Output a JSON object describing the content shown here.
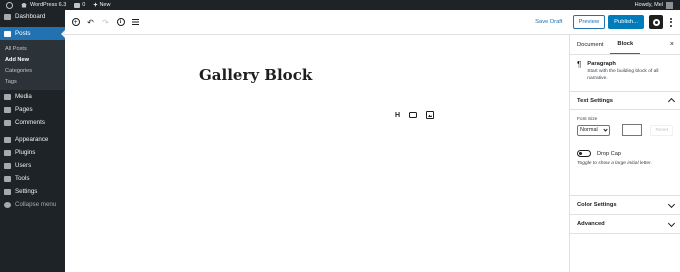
{
  "admin_bar": {
    "site_name": "WordPress 6.3",
    "comments_count": "0",
    "new_label": "New",
    "greeting": "Howdy, Mel"
  },
  "admin_menu": {
    "dashboard": "Dashboard",
    "posts": "Posts",
    "posts_submenu": [
      "All Posts",
      "Add New",
      "Categories",
      "Tags"
    ],
    "media": "Media",
    "pages": "Pages",
    "comments": "Comments",
    "appearance": "Appearance",
    "plugins": "Plugins",
    "users": "Users",
    "tools": "Tools",
    "settings": "Settings",
    "collapse": "Collapse menu"
  },
  "toolbar": {
    "add_block_icon": "plus-circle-icon",
    "undo_icon": "undo-icon",
    "redo_icon": "redo-icon",
    "details_icon": "info-icon",
    "list_view_icon": "list-view-icon",
    "save_draft": "Save Draft",
    "preview": "Preview",
    "publish": "Publish...",
    "settings_icon": "gear-icon",
    "more_icon": "more-vertical-icon"
  },
  "editor": {
    "title": "Gallery Block",
    "block_tools": {
      "heading": "H",
      "icons": [
        "button-block-icon",
        "image-block-icon"
      ]
    }
  },
  "sidebar": {
    "tabs": [
      "Document",
      "Block"
    ],
    "active_tab": "Block",
    "close": "×",
    "block_card": {
      "title": "Paragraph",
      "description": "Start with the building block of all narrative."
    },
    "text_settings": {
      "heading": "Text Settings",
      "font_size_label": "Font Size",
      "font_size_value": "Normal",
      "reset": "Reset",
      "drop_cap_label": "Drop Cap",
      "drop_cap_help": "Toggle to show a large initial letter."
    },
    "color_settings": "Color Settings",
    "advanced": "Advanced"
  },
  "colors": {
    "admin_dark": "#1d2327",
    "accent": "#007cba",
    "menu_current": "#2271b1"
  }
}
